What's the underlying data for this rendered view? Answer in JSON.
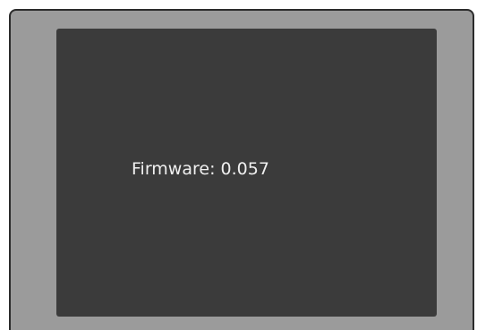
{
  "display": {
    "firmware_text": "Firmware: 0.057"
  },
  "colors": {
    "bezel": "#9b9b9b",
    "screen": "#3b3b3b",
    "text": "#f0f0f0"
  }
}
